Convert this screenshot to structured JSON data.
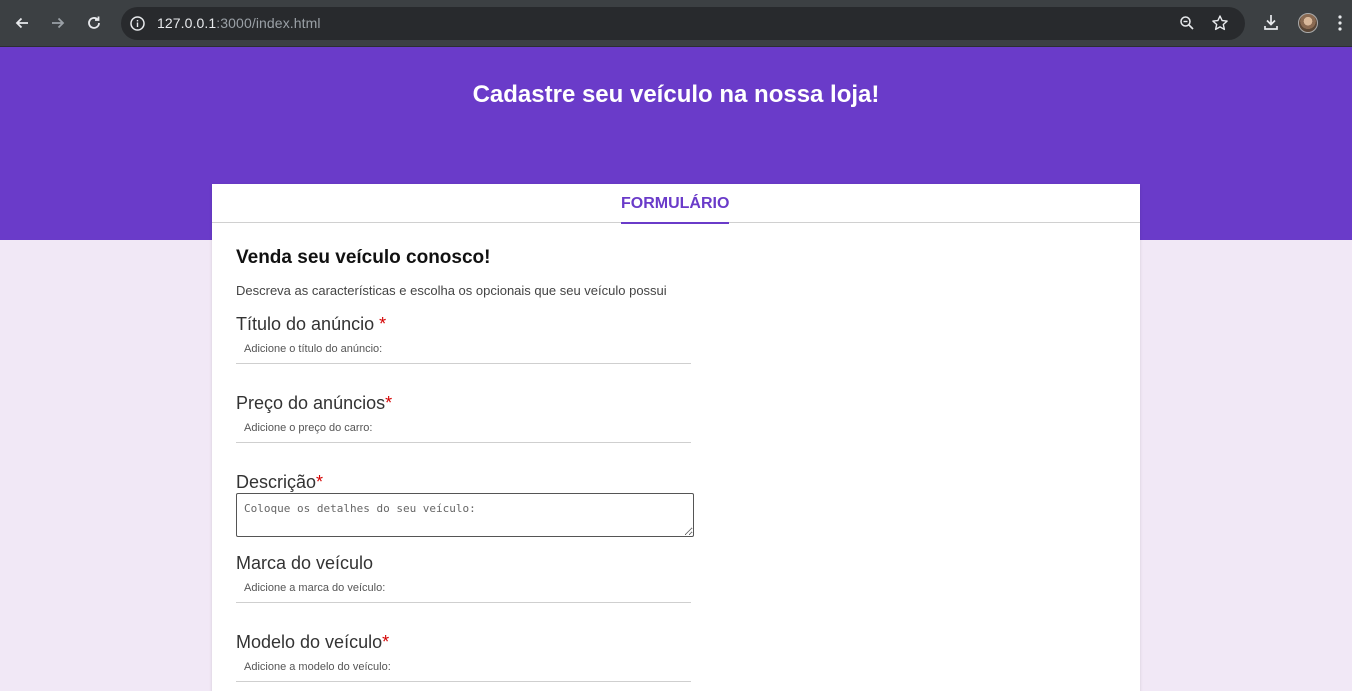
{
  "browser": {
    "url_host": "127.0.0.1",
    "url_rest": ":3000/index.html",
    "icons": [
      "back-arrow-icon",
      "forward-arrow-icon",
      "reload-icon",
      "site-info-icon",
      "zoom-icon",
      "bookmark-star-icon",
      "download-icon",
      "profile-avatar",
      "kebab-menu-icon"
    ]
  },
  "header": {
    "title": "Cadastre seu veículo na nossa loja!"
  },
  "tabs": {
    "active_label": "FORMULÁRIO"
  },
  "form": {
    "title": "Venda seu veículo conosco!",
    "description": "Descreva as características e escolha os opcionais que seu veículo possui",
    "fields": [
      {
        "label": "Título do anúncio ",
        "required_mark": "*",
        "placeholder": "Adicione o título do anúncio:",
        "value": ""
      },
      {
        "label": "Preço do anúncios",
        "required_mark": "*",
        "placeholder": "Adicione o preço do carro:",
        "value": ""
      },
      {
        "label": "Descrição",
        "required_mark": "*",
        "placeholder": "Coloque os detalhes do seu veículo:",
        "value": ""
      },
      {
        "label": "Marca do veículo",
        "required_mark": "",
        "placeholder": "Adicione a marca do veículo:",
        "value": ""
      },
      {
        "label": "Modelo do veículo",
        "required_mark": "*",
        "placeholder": "Adicione a modelo do veículo:",
        "value": ""
      }
    ]
  },
  "colors": {
    "brand_purple": "#6a3bc9",
    "page_background": "#f1e8f6",
    "required_red": "#d40000",
    "chrome_dark": "#3c4043"
  }
}
